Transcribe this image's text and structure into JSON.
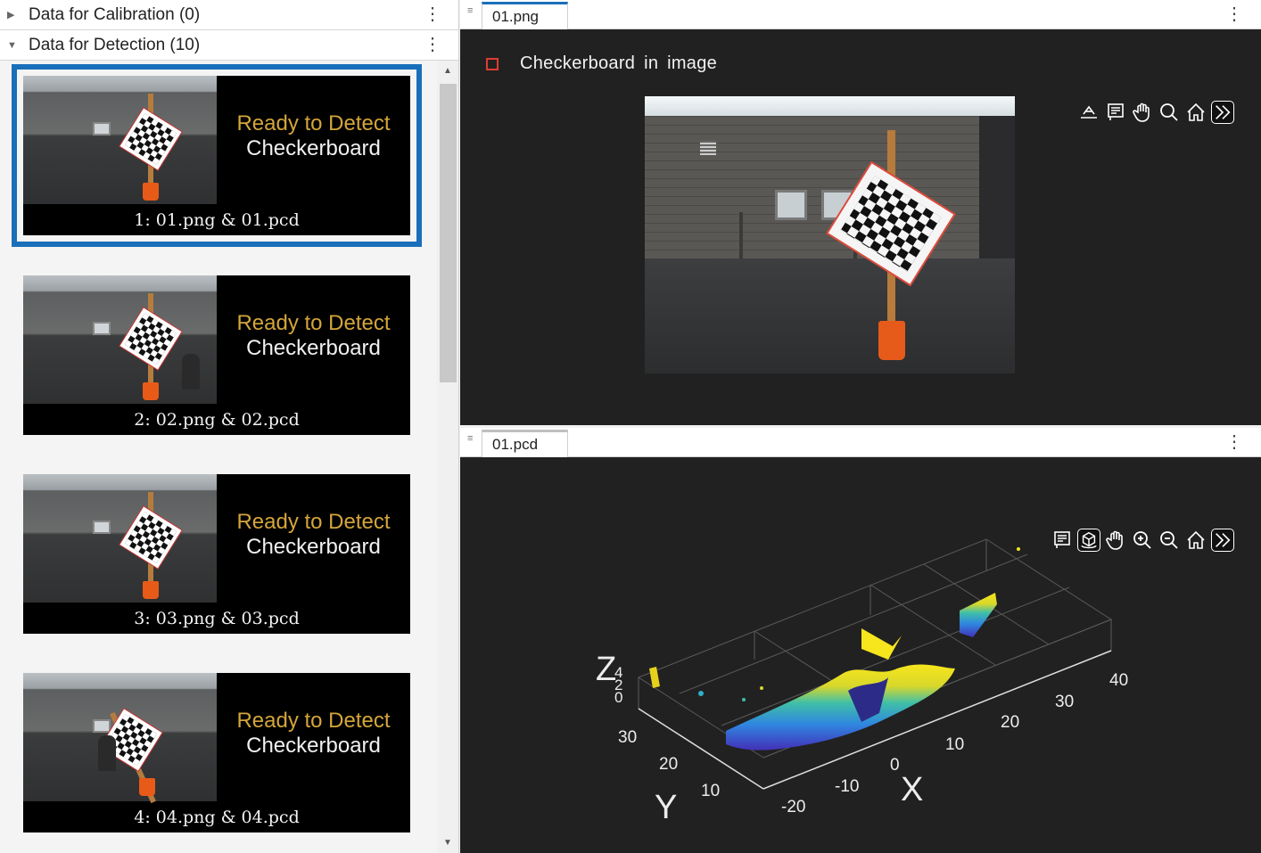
{
  "left_panel": {
    "calibration_header": "Data for Calibration (0)",
    "detection_header": "Data for Detection (10)",
    "thumbnails": [
      {
        "status_line1": "Ready to Detect",
        "status_line2": "Checkerboard",
        "caption": "1: 01.png & 01.pcd"
      },
      {
        "status_line1": "Ready to Detect",
        "status_line2": "Checkerboard",
        "caption": "2: 02.png & 02.pcd"
      },
      {
        "status_line1": "Ready to Detect",
        "status_line2": "Checkerboard",
        "caption": "3: 03.png & 03.pcd"
      },
      {
        "status_line1": "Ready to Detect",
        "status_line2": "Checkerboard",
        "caption": "4: 04.png & 04.pcd"
      }
    ]
  },
  "image_pane": {
    "tab_label": "01.png",
    "legend_text": "Checkerboard in image",
    "legend_color": "#e03c31",
    "toolbar_icons": [
      "restore-view-icon",
      "data-tips-icon",
      "pan-icon",
      "zoom-icon",
      "home-icon",
      "expand-icon"
    ]
  },
  "pointcloud_pane": {
    "tab_label": "01.pcd",
    "toolbar_icons": [
      "data-tips-icon",
      "rotate-3d-icon",
      "pan-icon",
      "zoom-in-icon",
      "zoom-out-icon",
      "home-icon",
      "expand-icon"
    ],
    "axis_labels": {
      "x": "X",
      "y": "Y",
      "z": "Z"
    },
    "x_ticks": [
      "-20",
      "-10",
      "0",
      "10",
      "20",
      "30",
      "40"
    ],
    "y_ticks": [
      "10",
      "20",
      "30"
    ],
    "z_ticks": [
      "0",
      "2",
      "4"
    ]
  },
  "colors": {
    "accent": "#1a6fba",
    "pane_bg": "#212121",
    "status_yellow": "#d4a53a"
  }
}
